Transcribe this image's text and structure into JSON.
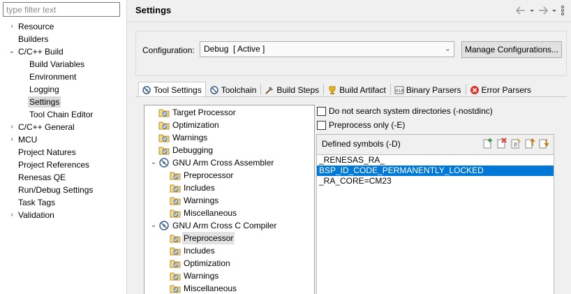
{
  "nav": {
    "filter_placeholder": "type filter text",
    "items": [
      {
        "label": "Resource",
        "expander": "right"
      },
      {
        "label": "Builders",
        "expander": "none"
      },
      {
        "label": "C/C++ Build",
        "expander": "down"
      },
      {
        "label": "Build Variables",
        "expander": "none"
      },
      {
        "label": "Environment",
        "expander": "none"
      },
      {
        "label": "Logging",
        "expander": "none"
      },
      {
        "label": "Settings",
        "expander": "none",
        "selected": true
      },
      {
        "label": "Tool Chain Editor",
        "expander": "none"
      },
      {
        "label": "C/C++ General",
        "expander": "right"
      },
      {
        "label": "MCU",
        "expander": "right"
      },
      {
        "label": "Project Natures",
        "expander": "none"
      },
      {
        "label": "Project References",
        "expander": "none"
      },
      {
        "label": "Renesas QE",
        "expander": "none"
      },
      {
        "label": "Run/Debug Settings",
        "expander": "none"
      },
      {
        "label": "Task Tags",
        "expander": "none"
      },
      {
        "label": "Validation",
        "expander": "right"
      }
    ]
  },
  "page": {
    "title": "Settings",
    "header_icons": [
      "back-arrow-icon",
      "back-menu-icon",
      "forward-arrow-icon",
      "forward-menu-icon",
      "view-menu-icon"
    ]
  },
  "configuration": {
    "label": "Configuration:",
    "value": "Debug  [ Active ]",
    "manage_button": "Manage Configurations..."
  },
  "tabs": [
    {
      "label": "Tool Settings",
      "icon": "tool-settings-icon",
      "active": true
    },
    {
      "label": "Toolchain",
      "icon": "toolchain-icon"
    },
    {
      "label": "Build Steps",
      "icon": "build-steps-icon"
    },
    {
      "label": "Build Artifact",
      "icon": "build-artifact-icon"
    },
    {
      "label": "Binary Parsers",
      "icon": "binary-parsers-icon"
    },
    {
      "label": "Error Parsers",
      "icon": "error-parsers-icon"
    }
  ],
  "tool_tree": [
    {
      "label": "Target Processor",
      "level": 1
    },
    {
      "label": "Optimization",
      "level": 1
    },
    {
      "label": "Warnings",
      "level": 1
    },
    {
      "label": "Debugging",
      "level": 1
    },
    {
      "label": "GNU Arm Cross Assembler",
      "level": 0,
      "expanded": true
    },
    {
      "label": "Preprocessor",
      "level": 2
    },
    {
      "label": "Includes",
      "level": 2
    },
    {
      "label": "Warnings",
      "level": 2
    },
    {
      "label": "Miscellaneous",
      "level": 2
    },
    {
      "label": "GNU Arm Cross C Compiler",
      "level": 0,
      "expanded": true
    },
    {
      "label": "Preprocessor",
      "level": 2,
      "selected": true
    },
    {
      "label": "Includes",
      "level": 2
    },
    {
      "label": "Optimization",
      "level": 2
    },
    {
      "label": "Warnings",
      "level": 2
    },
    {
      "label": "Miscellaneous",
      "level": 2
    }
  ],
  "options": {
    "nostdinc_label": "Do not search system directories (-nostdinc)",
    "nostdinc_checked": false,
    "preprocess_label": "Preprocess only (-E)",
    "preprocess_checked": false
  },
  "symbols": {
    "header": "Defined symbols (-D)",
    "tools": [
      "add-icon",
      "delete-icon",
      "edit-icon",
      "move-up-icon",
      "move-down-icon"
    ],
    "items": [
      {
        "value": "_RENESAS_RA_"
      },
      {
        "value": "BSP_ID_CODE_PERMANENTLY_LOCKED",
        "selected": true
      },
      {
        "value": "_RA_CORE=CM23"
      }
    ]
  }
}
